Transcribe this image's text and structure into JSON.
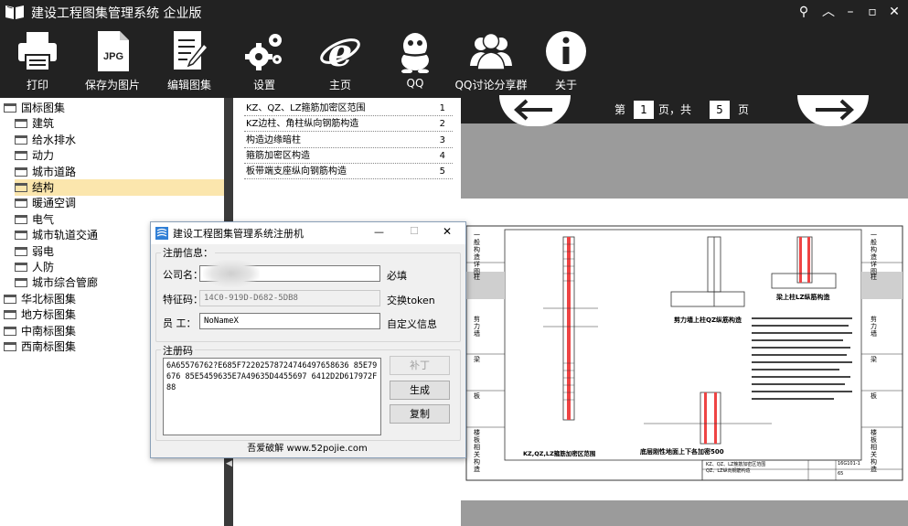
{
  "app": {
    "title": "建设工程图集管理系统  企业版"
  },
  "window_controls": {
    "pin": "⚲",
    "up": "︿",
    "minimize": "–",
    "maximize": "▫",
    "close": "✕"
  },
  "toolbar": {
    "print": "打印",
    "save_image": "保存为图片",
    "edit": "编辑图集",
    "settings": "设置",
    "home": "主页",
    "qq": "QQ",
    "qq_group": "QQ讨论分享群",
    "about": "关于",
    "jpg_badge": "JPG"
  },
  "tree": {
    "items": [
      {
        "label": "国标图集",
        "level": 0
      },
      {
        "label": "建筑",
        "level": 1
      },
      {
        "label": "给水排水",
        "level": 1
      },
      {
        "label": "动力",
        "level": 1
      },
      {
        "label": "城市道路",
        "level": 1
      },
      {
        "label": "结构",
        "level": 1,
        "selected": true
      },
      {
        "label": "暖通空调",
        "level": 1
      },
      {
        "label": "电气",
        "level": 1
      },
      {
        "label": "城市轨道交通",
        "level": 1
      },
      {
        "label": "弱电",
        "level": 1
      },
      {
        "label": "人防",
        "level": 1
      },
      {
        "label": "城市综合管廊",
        "level": 1
      },
      {
        "label": "华北标图集",
        "level": 0
      },
      {
        "label": "地方标图集",
        "level": 0
      },
      {
        "label": "中南标图集",
        "level": 0
      },
      {
        "label": "西南标图集",
        "level": 0
      }
    ]
  },
  "toc": {
    "rows": [
      {
        "title": "KZ、QZ、LZ箍筋加密区范围",
        "page": "1"
      },
      {
        "title": "KZ边柱、角柱纵向钢筋构造",
        "page": "2"
      },
      {
        "title": "构造边缘暗柱",
        "page": "3"
      },
      {
        "title": "箍筋加密区构造",
        "page": "4"
      },
      {
        "title": "板带端支座纵向钢筋构造",
        "page": "5"
      }
    ]
  },
  "pager": {
    "prefix": "第",
    "current": "1",
    "mid": "页，共",
    "total": "5",
    "suffix": "页"
  },
  "dialog": {
    "title": "建设工程图集管理系统注册机",
    "minimize": "—",
    "maximize": "☐",
    "close": "✕",
    "reg_info_label": "注册信息：",
    "company_label": "公司名：",
    "company_value": "",
    "company_note": "必填",
    "feature_label": "特征码：",
    "feature_value": "14C0-919D-D682-5DB8",
    "feature_note": "交换token",
    "staff_label": "员  工：",
    "staff_value": "NoNameX",
    "staff_note": "自定义信息",
    "reg_code_label": "注册码",
    "reg_code_value": "6A65576762?E685F72202578724746497658636 85E79676 85E5459635E7A49635D4455697 6412D2D617972F88",
    "btn_patch": "补丁",
    "btn_generate": "生成",
    "btn_copy": "复制",
    "footer": "吾爱破解 www.52pojie.com"
  },
  "drawing": {
    "side_labels": [
      "一般构造详图",
      "柱",
      "剪力墙",
      "梁",
      "板",
      "楼板相关构造"
    ],
    "title_mid": "剪力墙上柱QZ纵筋构造",
    "title_right": "梁上柱LZ纵筋构造",
    "title_bottom": "底层刚性地面上下各加密500",
    "title_left": "KZ,QZ,LZ箍筋加密区范围",
    "sheet_caption": "KZ、QZ、LZ箍筋加密区范围\nQZ、LZ纵向钢筋构造",
    "atlas_no": "16G101-1",
    "page_no": "65"
  }
}
